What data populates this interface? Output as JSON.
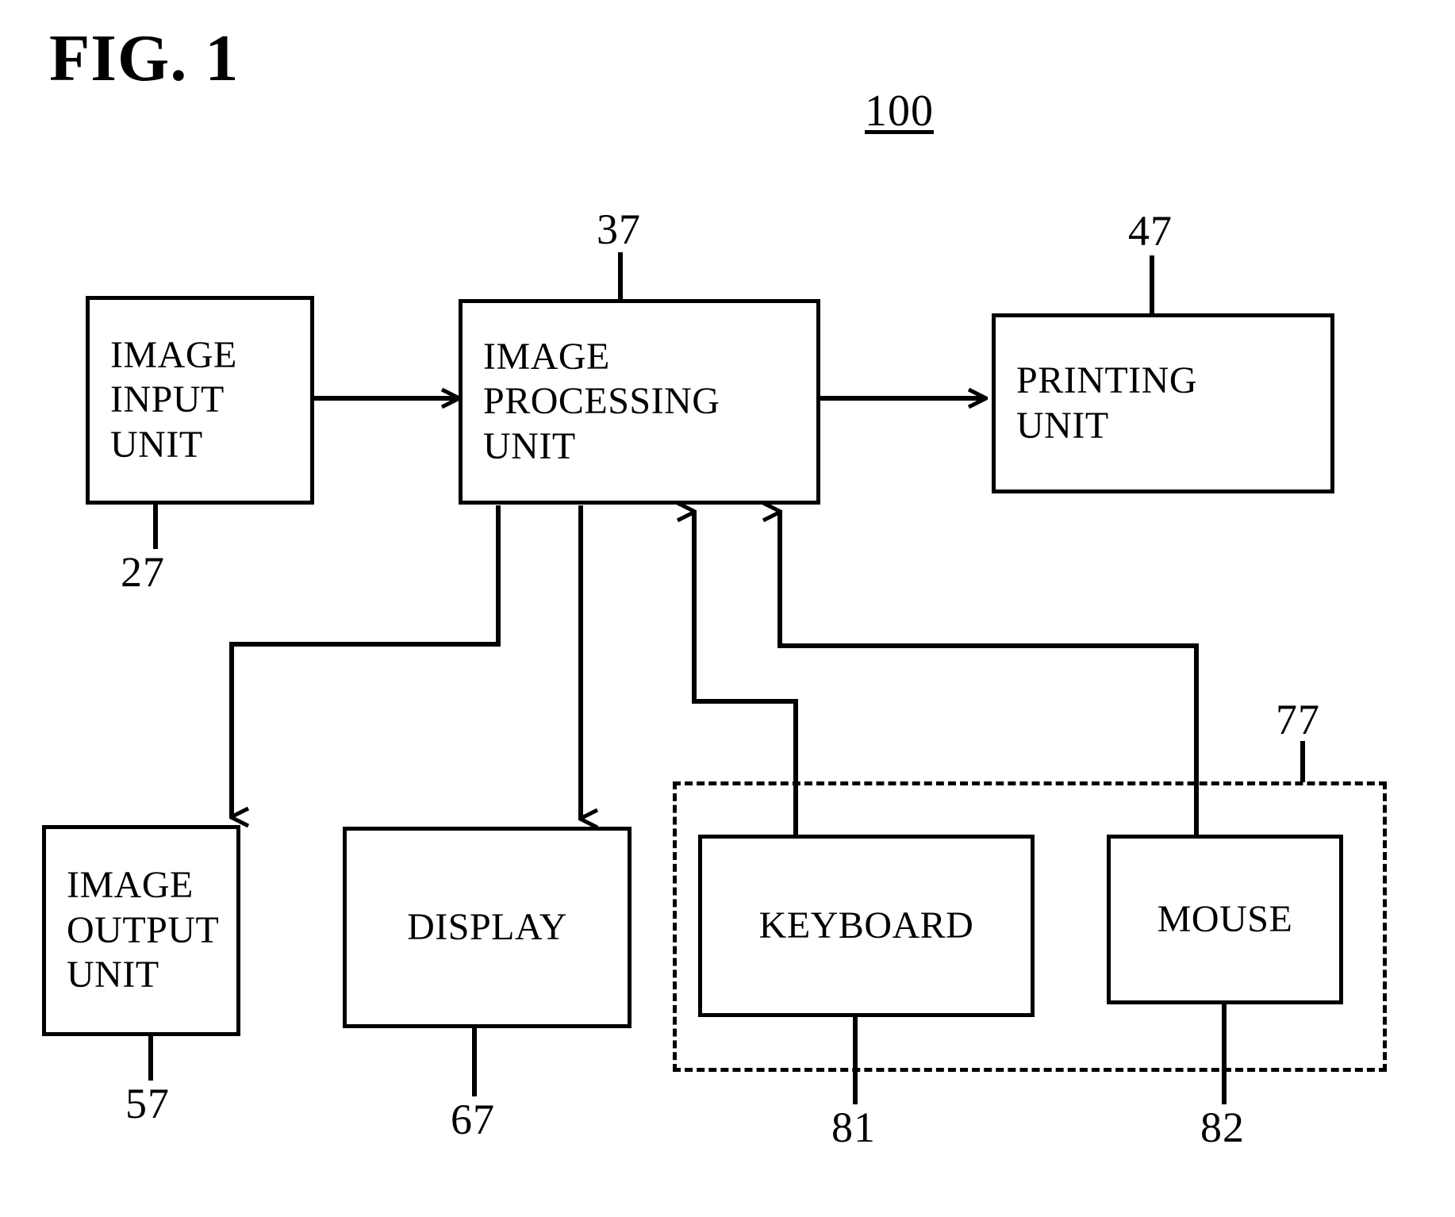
{
  "figure": {
    "title": "FIG. 1",
    "assembly_ref": "100"
  },
  "blocks": [
    {
      "id": "image-input-unit",
      "label": "IMAGE\nINPUT\nUNIT",
      "ref": "27"
    },
    {
      "id": "image-processing-unit",
      "label": "IMAGE\nPROCESSING\nUNIT",
      "ref": "37"
    },
    {
      "id": "printing-unit",
      "label": "PRINTING\nUNIT",
      "ref": "47"
    },
    {
      "id": "image-output-unit",
      "label": "IMAGE\nOUTPUT\nUNIT",
      "ref": "57"
    },
    {
      "id": "display",
      "label": "DISPLAY",
      "ref": "67"
    },
    {
      "id": "keyboard",
      "label": "KEYBOARD",
      "ref": "81"
    },
    {
      "id": "mouse",
      "label": "MOUSE",
      "ref": "82"
    }
  ],
  "groups": [
    {
      "id": "input-devices-group",
      "ref": "77"
    }
  ],
  "colors": {
    "stroke": "#000000",
    "background": "#ffffff"
  }
}
